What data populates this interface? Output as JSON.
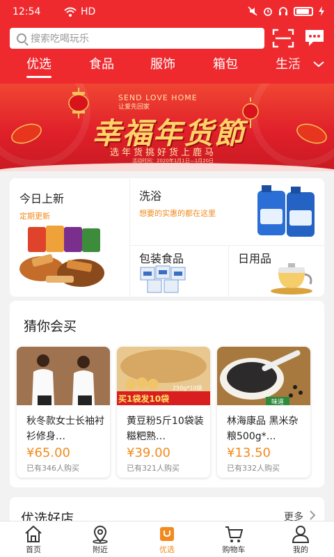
{
  "status_bar": {
    "time": "12:54",
    "network": "HD"
  },
  "search": {
    "placeholder": "搜索吃喝玩乐"
  },
  "header_icons": {
    "scan": "scan-icon",
    "message": "message-icon"
  },
  "categories": [
    {
      "label": "优选",
      "active": true
    },
    {
      "label": "食品",
      "active": false
    },
    {
      "label": "服饰",
      "active": false
    },
    {
      "label": "箱包",
      "active": false
    },
    {
      "label": "生活",
      "active": false
    }
  ],
  "banner": {
    "en": "SEND LOVE HOME",
    "en2": "让爱先回家",
    "title": "幸福年货節",
    "subtitle": "选年货挑好货上鹿马",
    "date": "活动时间：2020年1月1日—1月20日"
  },
  "feature": {
    "today_new": {
      "title": "今日上新",
      "subtitle": "定期更新"
    },
    "bath": {
      "title": "洗浴",
      "subtitle": "想要的实惠的都在这里"
    },
    "packaged_food": {
      "title": "包装食品"
    },
    "daily_goods": {
      "title": "日用品"
    }
  },
  "guess": {
    "title": "猜你会买",
    "products": [
      {
        "name": "秋冬款女士长袖衬衫修身…",
        "price": "¥65.00",
        "sold": "已有346人购买"
      },
      {
        "name": "黄豆粉5斤10袋装糍粑熟…",
        "price": "¥39.00",
        "sold": "已有321人购买",
        "promo": "买1袋发10袋",
        "promo_small": "250g*10袋"
      },
      {
        "name": "林海康品 黑米杂粮500g*…",
        "price": "¥13.50",
        "sold": "已有332人购买",
        "tag": "味道"
      }
    ]
  },
  "shops": {
    "title": "优选好店",
    "more": "更多"
  },
  "bottom_nav": [
    {
      "label": "首页",
      "icon": "home-icon",
      "active": false
    },
    {
      "label": "附近",
      "icon": "location-icon",
      "active": false
    },
    {
      "label": "优选",
      "icon": "bag-icon",
      "active": true
    },
    {
      "label": "购物车",
      "icon": "cart-icon",
      "active": false
    },
    {
      "label": "我的",
      "icon": "user-icon",
      "active": false
    }
  ],
  "colors": {
    "brand_red": "#ee2a2f",
    "accent_orange": "#f28a1e"
  }
}
